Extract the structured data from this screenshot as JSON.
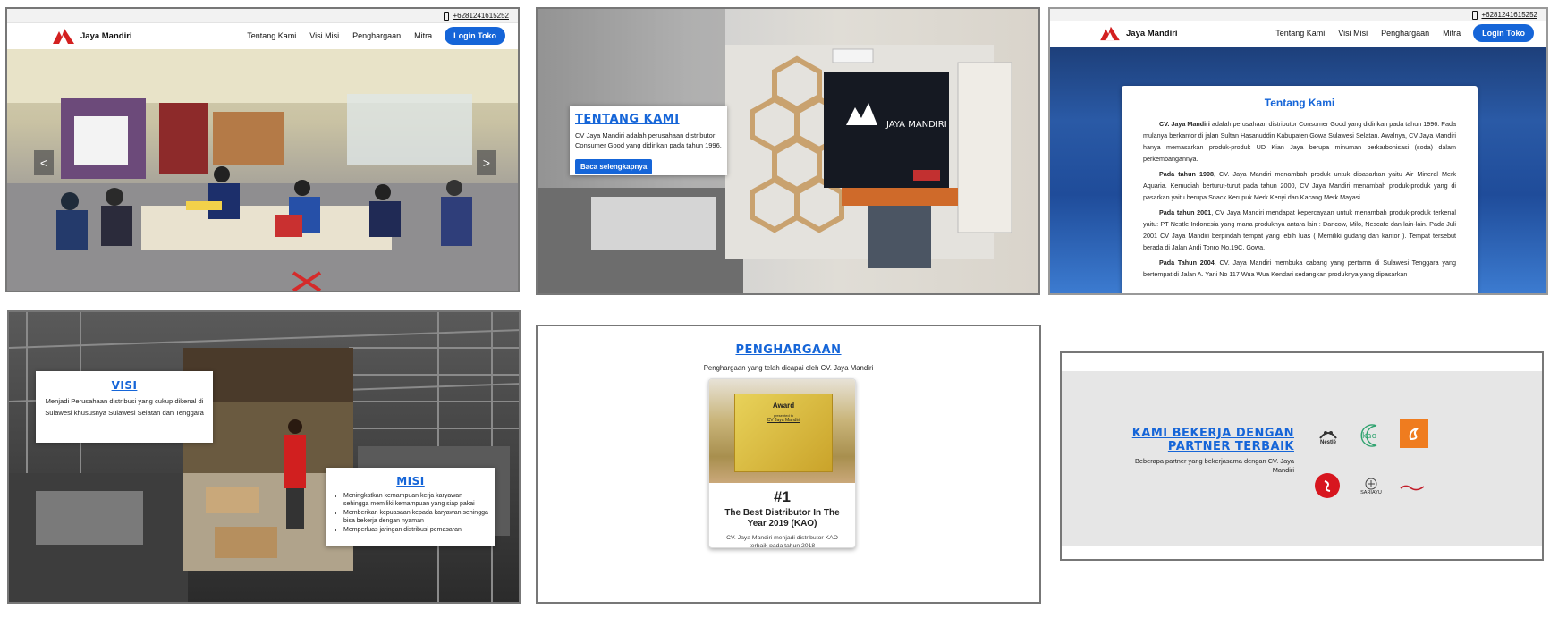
{
  "phone": "+6281241615252",
  "brand": "Jaya Mandiri",
  "nav": {
    "items": [
      "Tentang Kami",
      "Visi Misi",
      "Penghargaan",
      "Mitra"
    ],
    "login": "Login Toko"
  },
  "slider": {
    "prev": "<",
    "next": ">"
  },
  "tentang_hero": {
    "title": "TENTANG KAMI",
    "text": "CV Jaya Mandiri adalah perusahaan distributor Consumer Good yang didirikan pada tahun 1996.",
    "button": "Baca selengkapnya",
    "sign": "JAYA MANDIRI"
  },
  "about": {
    "title": "Tentang Kami",
    "p1_bold": "CV. Jaya Mandiri",
    "p1": " adalah perusahaan distributor Consumer Good yang didirikan pada tahun 1996. Pada mulanya berkantor di jalan Sultan Hasanuddin Kabupaten Gowa Sulawesi Selatan. Awalnya, CV Jaya Mandiri hanya memasarkan produk-produk UD Kian Jaya berupa minuman berkarbonisasi (soda) dalam perkembangannya.",
    "p2_bold": "Pada tahun 1998",
    "p2": ", CV. Jaya Mandiri menambah produk untuk dipasarkan yaitu Air Mineral Merk Aquaria. Kemudiah berturut-turut pada tahun 2000, CV Jaya Mandiri menambah produk-produk yang di pasarkan yaitu berupa Snack Kerupuk Merk Kenyi dan Kacang Merk Mayasi.",
    "p3_bold": "Pada tahun 2001",
    "p3": ", CV Jaya Mandiri mendapat kepercayaan untuk menambah produk-produk terkenal yaitu: PT Nestle Indonesia yang mana produknya antara lain : Dancow, Milo, Nescafe dan lain-lain. Pada Juli 2001 CV Jaya Mandiri berpindah tempat yang lebih luas ( Memiliki gudang dan kantor ). Tempat tersebut berada di Jalan Andi Tonro No.19C, Gowa.",
    "p4_bold": "Pada Tahun 2004",
    "p4": ", CV. Jaya Mandiri membuka cabang yang pertama di Sulawesi Tenggara yang bertempat di Jalan A. Yani No 117 Wua Wua Kendari sedangkan produknya yang dipasarkan"
  },
  "visi": {
    "title": "VISI",
    "text": "Menjadi Perusahaan distribusi yang cukup dikenal di Sulawesi khususnya Sulawesi Selatan dan Tenggara"
  },
  "misi": {
    "title": "MISI",
    "items": [
      "Meningkatkan kemampuan kerja karyawan sehingga memiliki kemampuan yang siap pakai",
      "Memberikan kepuasaan kepada karyawan sehingga bisa bekerja dengan nyaman",
      "Memperluas jaringan distribusi pemasaran"
    ]
  },
  "penghargaan": {
    "title": "PENGHARGAAN",
    "subtitle": "Penghargaan yang telah dicapai oleh CV. Jaya Mandiri",
    "plaque_title": "Award",
    "plaque_to": "presented to",
    "plaque_name": "CV Jaya Mandiri",
    "rank": "#1",
    "award_title": "The Best Distributor In The Year 2019 (KAO)",
    "award_desc": "CV. Jaya Mandiri menjadi distributor KAO terbaik pada tahun 2018"
  },
  "mitra": {
    "title": "KAMI BEKERJA DENGAN PARTNER TERBAIK",
    "text": "Beberapa partner yang bekerjasama dengan CV. Jaya Mandiri",
    "logos": [
      "Nestlé",
      "kao",
      "SARIAYU"
    ]
  },
  "colors": {
    "accent": "#1565d8",
    "card_border": "#777777",
    "mitra_bg": "#e6e6e6"
  }
}
